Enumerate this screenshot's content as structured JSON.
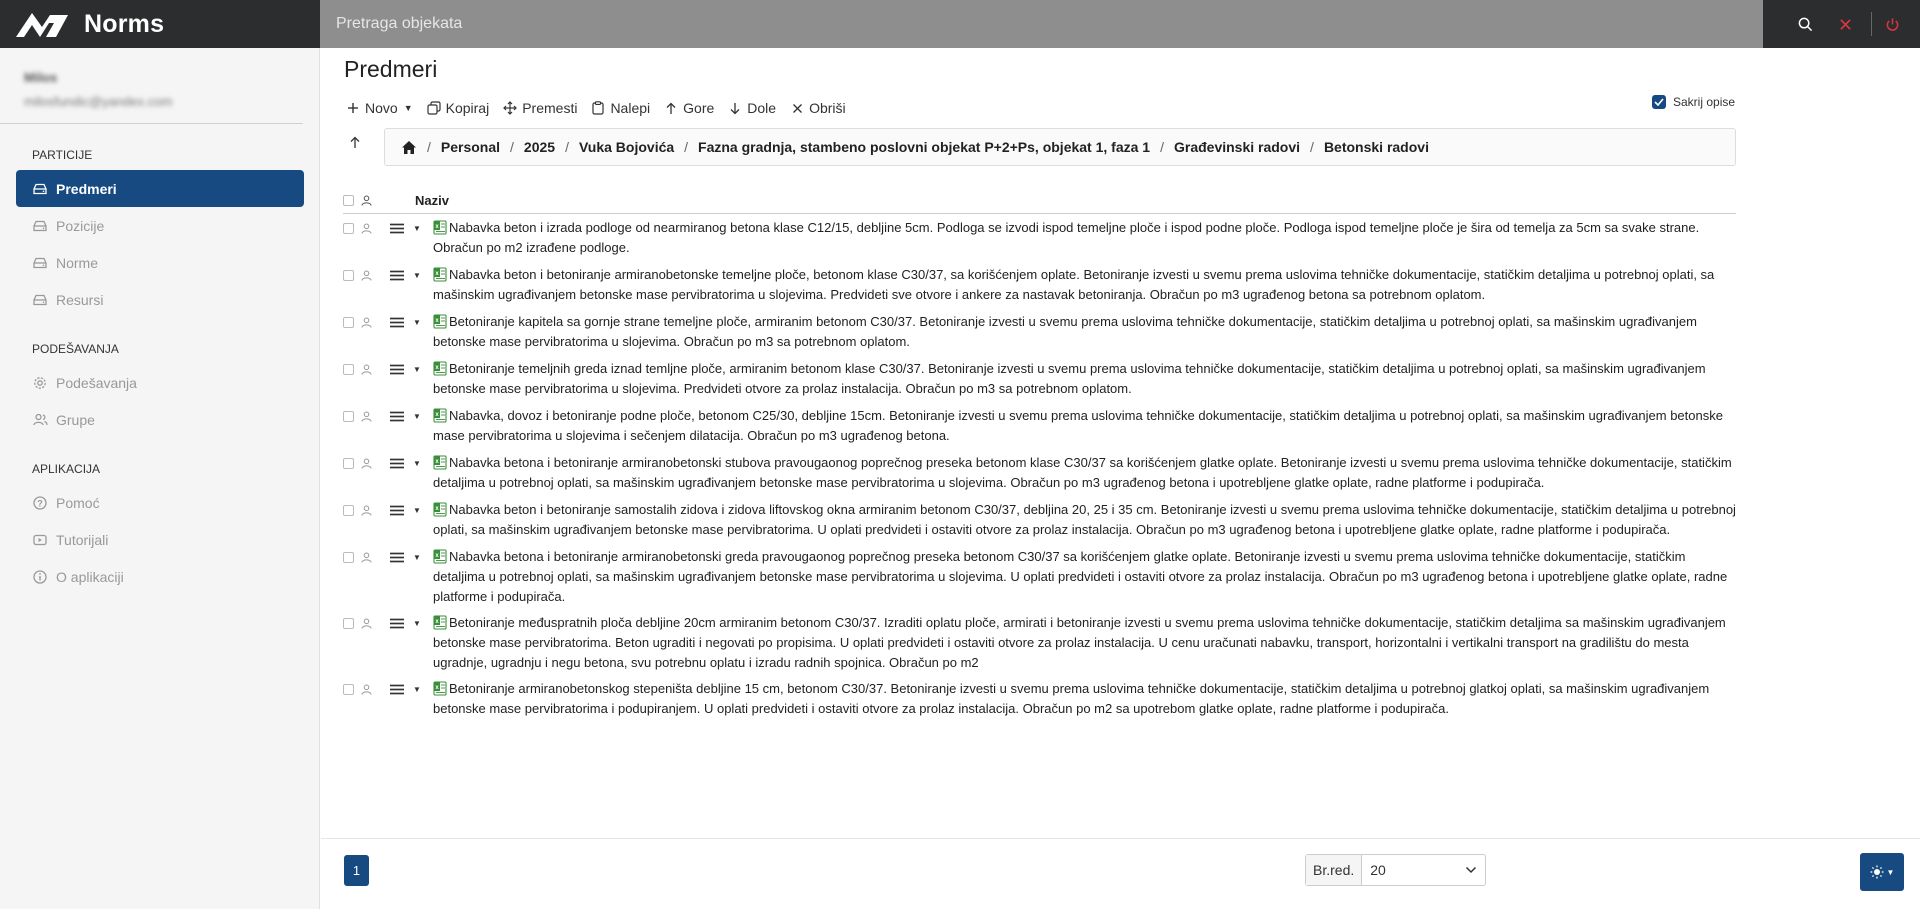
{
  "app": {
    "name": "Norms"
  },
  "search": {
    "placeholder": "Pretraga objekata"
  },
  "user": {
    "name": "Milos",
    "email": "milosfundic@yandex.com"
  },
  "sidebar": {
    "sections": [
      {
        "title": "PARTICIJE",
        "items": [
          {
            "label": "Predmeri",
            "icon": "drive-icon",
            "active": true
          },
          {
            "label": "Pozicije",
            "icon": "drive-icon"
          },
          {
            "label": "Norme",
            "icon": "drive-icon"
          },
          {
            "label": "Resursi",
            "icon": "drive-icon"
          }
        ]
      },
      {
        "title": "PODEŠAVANJA",
        "items": [
          {
            "label": "Podešavanja",
            "icon": "gear-icon"
          },
          {
            "label": "Grupe",
            "icon": "users-icon"
          }
        ]
      },
      {
        "title": "APLIKACIJA",
        "items": [
          {
            "label": "Pomoć",
            "icon": "question-icon"
          },
          {
            "label": "Tutorijali",
            "icon": "play-icon"
          },
          {
            "label": "O aplikaciji",
            "icon": "info-icon"
          }
        ]
      }
    ]
  },
  "page": {
    "title": "Predmeri"
  },
  "toolbar": {
    "new_label": "Novo",
    "copy_label": "Kopiraj",
    "move_label": "Premesti",
    "paste_label": "Nalepi",
    "up_label": "Gore",
    "down_label": "Dole",
    "delete_label": "Obriši",
    "hide_desc_label": "Sakrij opise"
  },
  "breadcrumb": [
    "Personal",
    "2025",
    "Vuka Bojovića",
    "Fazna gradnja, stambeno poslovni objekat P+2+Ps, objekat 1, faza 1",
    "Građevinski radovi",
    "Betonski radovi"
  ],
  "table": {
    "column_name": "Naziv",
    "rows": [
      "Nabavka beton i izrada podloge od nearmiranog betona klase C12/15, debljine 5cm. Podloga se izvodi ispod temeljne ploče i ispod podne ploče. Podloga ispod temeljne ploče je šira od temelja za 5cm sa svake strane. Obračun po m2 izrađene podloge.",
      "Nabavka beton i betoniranje armiranobetonske temeljne ploče, betonom klase C30/37, sa korišćenjem oplate. Betoniranje izvesti u svemu prema uslovima tehničke dokumentacije, statičkim detaljima u potrebnoj oplati, sa mašinskim ugrađivanjem betonske mase pervibratorima u slojevima. Predvideti sve otvore i ankere za nastavak betoniranja. Obračun po m3 ugrađenog betona sa potrebnom oplatom.",
      "Betoniranje kapitela sa gornje strane temeljne ploče, armiranim betonom C30/37. Betoniranje izvesti u svemu prema uslovima tehničke dokumentacije, statičkim detaljima u potrebnoj oplati, sa mašinskim ugrađivanjem betonske mase pervibratorima u slojevima. Obračun po m3 sa potrebnom oplatom.",
      "Betoniranje temeljnih greda iznad temljne ploče, armiranim betonom klase C30/37. Betoniranje izvesti u svemu prema uslovima tehničke dokumentacije, statičkim detaljima u potrebnoj oplati, sa mašinskim ugrađivanjem betonske mase pervibratorima u slojevima. Predvideti otvore za prolaz instalacija. Obračun po m3 sa potrebnom oplatom.",
      "Nabavka, dovoz i betoniranje podne ploče, betonom C25/30, debljine 15cm. Betoniranje izvesti u svemu prema uslovima tehničke dokumentacije, statičkim detaljima u potrebnoj oplati, sa mašinskim ugrađivanjem betonske mase pervibratorima u slojevima i sečenjem dilatacija. Obračun po m3 ugrađenog betona.",
      "Nabavka betona i betoniranje armiranobetonski stubova pravougaonog poprečnog preseka betonom klase C30/37 sa korišćenjem glatke oplate. Betoniranje izvesti u svemu prema uslovima tehničke dokumentacije, statičkim detaljima u potrebnoj oplati, sa mašinskim ugrađivanjem betonske mase pervibratorima u slojevima. Obračun po m3 ugrađenog betona i upotrebljene glatke oplate, radne platforme i podupirača.",
      "Nabavka beton i betoniranje samostalih zidova i zidova liftovskog okna armiranim betonom C30/37, debljina 20, 25 i 35 cm. Betoniranje izvesti u svemu prema uslovima tehničke dokumentacije, statičkim detaljima u potrebnoj oplati, sa mašinskim ugrađivanjem betonske mase pervibratorima. U oplati predvideti i ostaviti otvore za prolaz instalacija. Obračun po m3 ugrađenog betona i upotrebljene glatke oplate, radne platforme i podupirača.",
      "Nabavka betona i betoniranje armiranobetonski greda pravougaonog poprečnog preseka betonom C30/37 sa korišćenjem glatke oplate. Betoniranje izvesti u svemu prema uslovima tehničke dokumentacije, statičkim detaljima u potrebnoj oplati, sa mašinskim ugrađivanjem betonske mase pervibratorima u slojevima. U oplati predvideti i ostaviti otvore za prolaz instalacija. Obračun po m3 ugrađenog betona i upotrebljene glatke oplate, radne platforme i podupirača.",
      "Betoniranje međuspratnih ploča debljine 20cm armiranim betonom C30/37. Izraditi oplatu ploče, armirati i betoniranje izvesti u svemu prema uslovima tehničke dokumentacije, statičkim detaljima sa mašinskim ugrađivanjem betonske mase pervibratorima. Beton ugraditi i negovati po propisima. U oplati predvideti i ostaviti otvore za prolaz instalacija. U cenu uračunati nabavku, transport, horizontalni i vertikalni transport na gradilištu do mesta ugradnje, ugradnju i negu betona, svu potrebnu oplatu i izradu radnih spojnica. Obračun po m2",
      "Betoniranje armiranobetonskog stepeništa debljine 15 cm, betonom C30/37. Betoniranje izvesti u svemu prema uslovima tehničke dokumentacije, statičkim detaljima u potrebnoj glatkoj oplati, sa mašinskim ugrađivanjem betonske mase pervibratorima i podupiranjem. U oplati predvideti i ostaviti otvore za prolaz instalacija. Obračun po m2 sa upotrebom glatke oplate, radne platforme i podupirača."
    ]
  },
  "pagination": {
    "current_page": "1",
    "per_page_label": "Br.red.",
    "per_page_value": "20"
  },
  "colors": {
    "primary": "#164a80",
    "topbar": "#2b2d2f",
    "search_bg": "#8e8e8e",
    "close_red": "#d9363e"
  }
}
